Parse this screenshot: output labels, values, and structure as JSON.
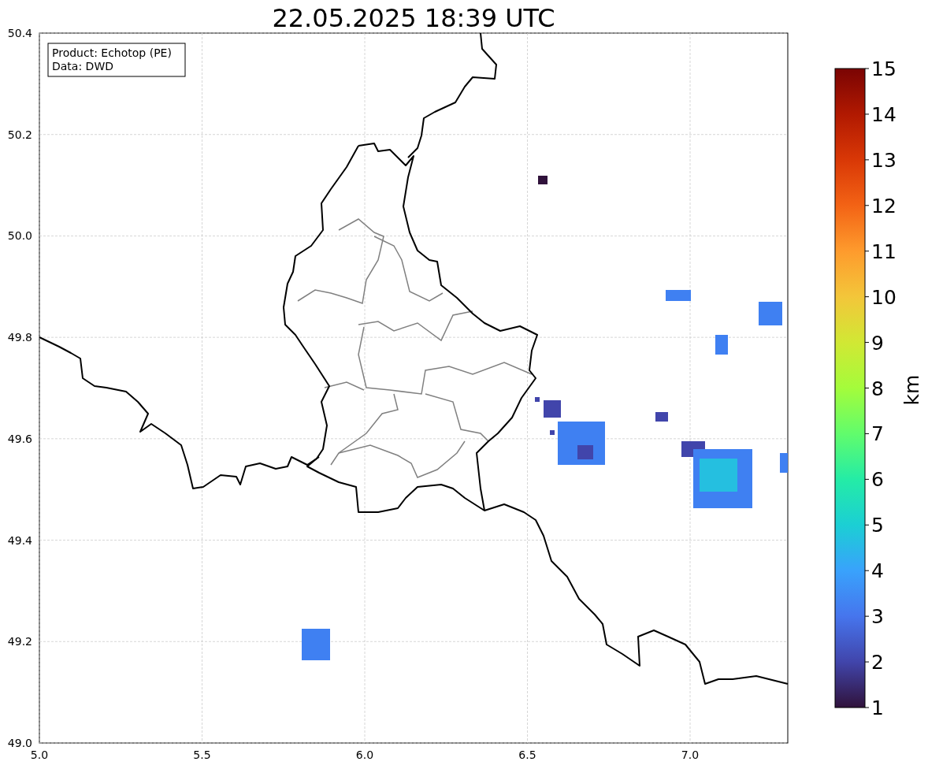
{
  "title": "22.05.2025 18:39 UTC",
  "info_box": [
    "Product: Echotop (PE)",
    "Data: DWD"
  ],
  "map": {
    "xticks": [
      "5.0",
      "5.5",
      "6.0",
      "6.5",
      "7.0"
    ],
    "yticks": [
      "50.4",
      "50.2",
      "50.0",
      "49.8",
      "49.6",
      "49.4",
      "49.2",
      "49.0"
    ]
  },
  "colorbar": {
    "label": "km",
    "ticks": [
      "15",
      "14",
      "13",
      "12",
      "11",
      "10",
      "9",
      "8",
      "7",
      "6",
      "5",
      "4",
      "3",
      "2",
      "1"
    ]
  }
}
